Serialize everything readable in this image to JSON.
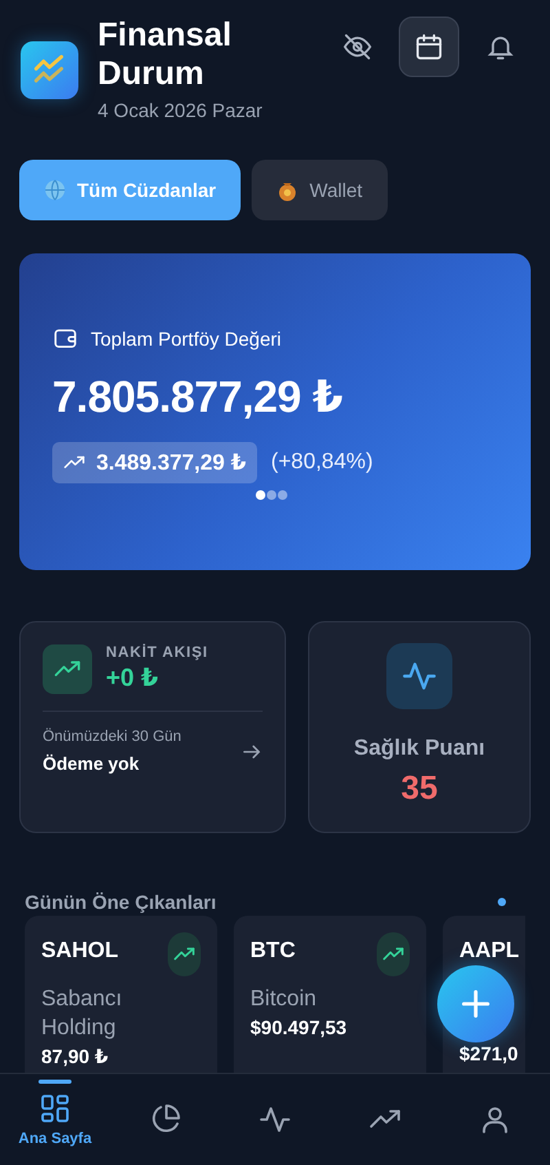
{
  "header": {
    "title": "Finansal Durum",
    "date": "4 Ocak 2026 Pazar"
  },
  "header_actions": [
    {
      "kind": "hide",
      "selected": false
    },
    {
      "kind": "calendar",
      "selected": true
    },
    {
      "kind": "bell",
      "selected": false
    }
  ],
  "wallet_tabs": [
    {
      "label": "Tüm Cüzdanlar",
      "kind": "globe",
      "selected": true
    },
    {
      "label": "Wallet",
      "kind": "bag",
      "selected": false
    }
  ],
  "portfolio": {
    "label": "Toplam Portföy Değeri",
    "value": "7.805.877,29 ₺",
    "change": "3.489.377,29 ₺",
    "change_percent": "(+80,84%)",
    "pages": [
      {
        "selected": true
      },
      {
        "selected": false
      },
      {
        "selected": false
      }
    ]
  },
  "cash_flow": {
    "label": "NAKİT AKIŞI",
    "value": "+0 ₺",
    "period": "Önümüzdeki 30 Gün",
    "status": "Ödeme yok"
  },
  "health": {
    "label": "Sağlık Puanı",
    "score": "35"
  },
  "highlights": {
    "title": "Günün Öne Çıkanları",
    "items": [
      {
        "symbol": "SAHOL",
        "name": "Sabancı Holding",
        "price": "87,90 ₺",
        "trend": true
      },
      {
        "symbol": "BTC",
        "name": "Bitcoin",
        "price": "$90.497,53",
        "trend": true
      },
      {
        "symbol": "AAPL",
        "price": "$271,0",
        "trend": false
      }
    ]
  },
  "nav": [
    {
      "label": "Ana Sayfa",
      "kind": "grid",
      "selected": true
    },
    {
      "kind": "pie",
      "selected": false
    },
    {
      "kind": "pulse",
      "selected": false
    },
    {
      "kind": "trend",
      "selected": false
    },
    {
      "kind": "user",
      "selected": false
    }
  ]
}
